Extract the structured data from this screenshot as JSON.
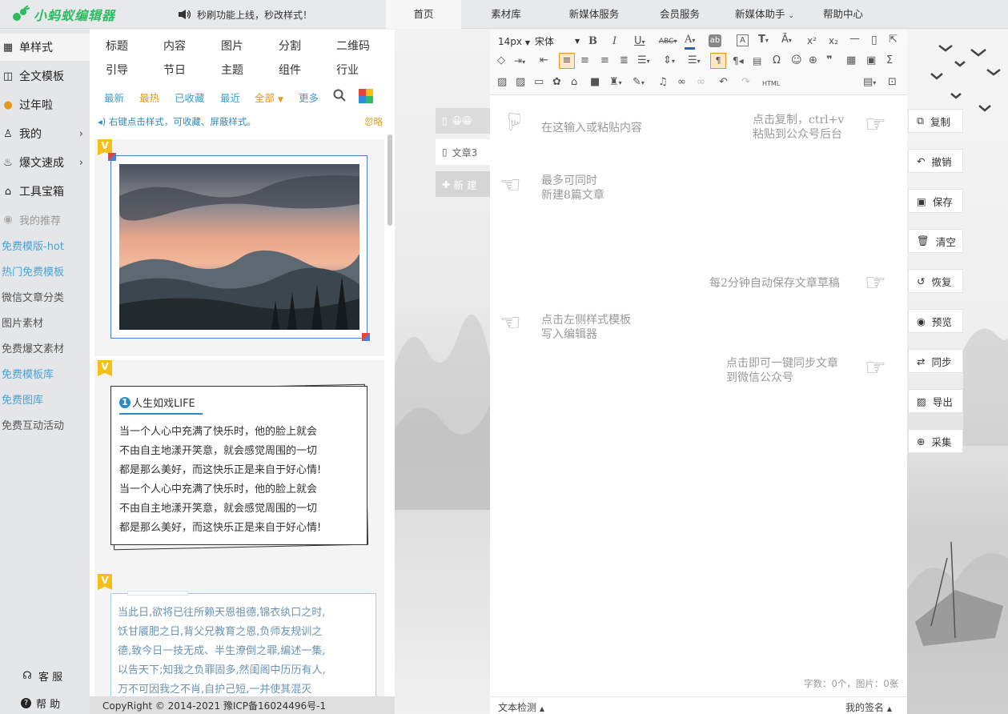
{
  "app": {
    "logo_text": "小蚂蚁编辑器",
    "announcement": "秒刷功能上线，秒改样式！"
  },
  "nav": {
    "tabs": [
      "首页",
      "素材库",
      "新媒体服务",
      "会员服务",
      "新媒体助手",
      "帮助中心"
    ],
    "active": "首页"
  },
  "sidebar": {
    "items": [
      {
        "label": "单样式",
        "icon": "grid-icon"
      },
      {
        "label": "全文模板",
        "icon": "layout-icon"
      },
      {
        "label": "过年啦",
        "icon": "lantern-icon"
      },
      {
        "label": "我的",
        "icon": "user-icon"
      },
      {
        "label": "爆文速成",
        "icon": "fire-icon"
      },
      {
        "label": "工具宝箱",
        "icon": "toolbox-icon"
      }
    ],
    "recommend_label": "我的推荐",
    "links": [
      {
        "label": "免费模版-hot",
        "color": "#4aa3d8"
      },
      {
        "label": "热门免费模板",
        "color": "#4aa3d8"
      },
      {
        "label": "微信文章分类",
        "color": "#555555"
      },
      {
        "label": "图片素材",
        "color": "#555555"
      },
      {
        "label": "免费爆文素材",
        "color": "#555555"
      },
      {
        "label": "免费模板库",
        "color": "#4aa3d8"
      },
      {
        "label": "免费图库",
        "color": "#4aa3d8"
      },
      {
        "label": "免费互动活动",
        "color": "#555555"
      }
    ],
    "service": "客 服",
    "help": "帮 助"
  },
  "panel": {
    "categories_row1": [
      "标题",
      "内容",
      "图片",
      "分割",
      "二维码"
    ],
    "categories_row2": [
      "引导",
      "节日",
      "主题",
      "组件",
      "行业"
    ],
    "filters": [
      "最新",
      "最热",
      "已收藏",
      "最近",
      "全部",
      "更多"
    ],
    "tip": "右键点击样式，可收藏、屏蔽样式。",
    "ignore": "忽略",
    "card2": {
      "heading": "人生如戏LIFE",
      "number": "1",
      "lines": [
        "当一个人心中充满了快乐时，他的脸上就会",
        "不由自主地漾开笑意，就会感觉周围的一切",
        "都是那么美好，而这快乐正是来自于好心情!",
        "当一个人心中充满了快乐时，他的脸上就会",
        "不由自主地漾开笑意，就会感觉周围的一切",
        "都是那么美好，而这快乐正是来自于好心情!"
      ]
    },
    "card3": {
      "lines": [
        "当此日,欲将已往所赖天恩祖德,锦衣纨口之时,",
        "饫甘餍肥之日,背父兄教育之恩,负师友规训之",
        "德,致今日一技无成、半生潦倒之罪,编述一集,",
        "以告天下;知我之负罪固多,然闺阁中历历有人,",
        "万不可因我之不肖,自护己短,一并使其混灭"
      ]
    }
  },
  "footer": {
    "copyright": "CopyRight © 2014-2021 豫ICP备16024496号-1"
  },
  "doc_tabs": {
    "tab1": "😀😀",
    "tab2": "文章3",
    "new": "新 建"
  },
  "toolbar": {
    "font_size": "14px",
    "font_family": "宋体",
    "html_label": "HTML"
  },
  "editor": {
    "hints": {
      "paste": "在这输入或粘贴内容",
      "copy_l1": "点击复制，ctrl+v",
      "copy_l2": "粘贴到公众号后台",
      "max_l1": "最多可同时",
      "max_l2": "新建8篇文章",
      "autosave": "每2分钟自动保存文章草稿",
      "template_l1": "点击左侧样式模板",
      "template_l2": "写入编辑器",
      "sync_l1": "点击即可一键同步文章",
      "sync_l2": "到微信公众号"
    },
    "counter": "字数：0个，图片：0张",
    "text_check": "文本检测",
    "signature": "我的签名"
  },
  "actions": [
    "复制",
    "撤销",
    "保存",
    "清空",
    "恢复",
    "预览",
    "同步",
    "导出",
    "采集"
  ],
  "colors": {
    "brand": "#2ebc63",
    "link": "#3a9fd6",
    "accent": "#f5bf17",
    "orange": "#e8961e"
  }
}
